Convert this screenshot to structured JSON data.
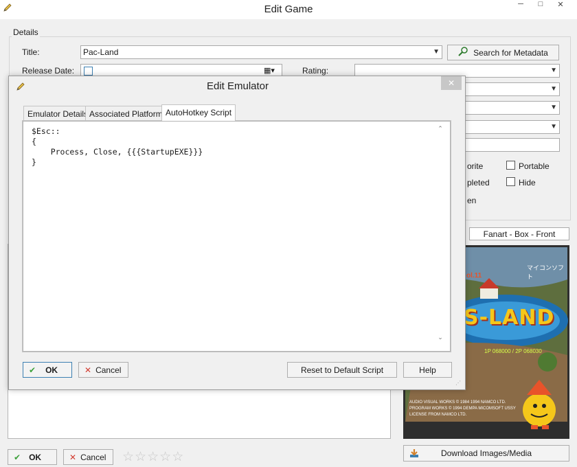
{
  "main_window": {
    "title": "Edit Game",
    "controls": {
      "minimize": "─",
      "maximize": "□",
      "close": "✕"
    },
    "details_label": "Details",
    "title_label": "Title:",
    "title_value": "Pac-Land",
    "search_metadata": "Search for Metadata",
    "release_date_label": "Release Date:",
    "rating_label": "Rating:",
    "checks": {
      "favorite_partial": "orite",
      "portable": "Portable",
      "completed_partial": "pleted",
      "hide": "Hide",
      "broken_partial": "en"
    },
    "image_type": "Fanart - Box - Front",
    "download_button": "Download Images/Media",
    "ok": "OK",
    "cancel": "Cancel",
    "stars": [
      "☆",
      "☆",
      "☆",
      "☆",
      "☆"
    ]
  },
  "image_text": {
    "title_art": "S-LAND",
    "vol": "ol.11",
    "publisher": "マイコンソフト",
    "score": "1P 068000 / 2P 068030",
    "credits_line1": "AUDIO VISUAL WORKS © 1984 1994 NAMCO LTD.",
    "credits_line2": "PROGRAM WORKS © 1994 DEMPA MICOMSOFT USSY",
    "credits_line3": "LICENSE FROM NAMCO LTD."
  },
  "dialog": {
    "title": "Edit Emulator",
    "close": "✕",
    "tabs": [
      "Emulator Details",
      "Associated Platforms",
      "AutoHotkey Script"
    ],
    "active_tab": "AutoHotkey Script",
    "script": "$Esc::\n{\n    Process, Close, {{{StartupEXE}}}\n}",
    "ok": "OK",
    "cancel": "Cancel",
    "reset": "Reset to Default Script",
    "help": "Help"
  },
  "colors": {
    "ok_check": "#3ca13a",
    "cancel_x": "#d23b2f",
    "accent_border": "#3c7fb1"
  }
}
